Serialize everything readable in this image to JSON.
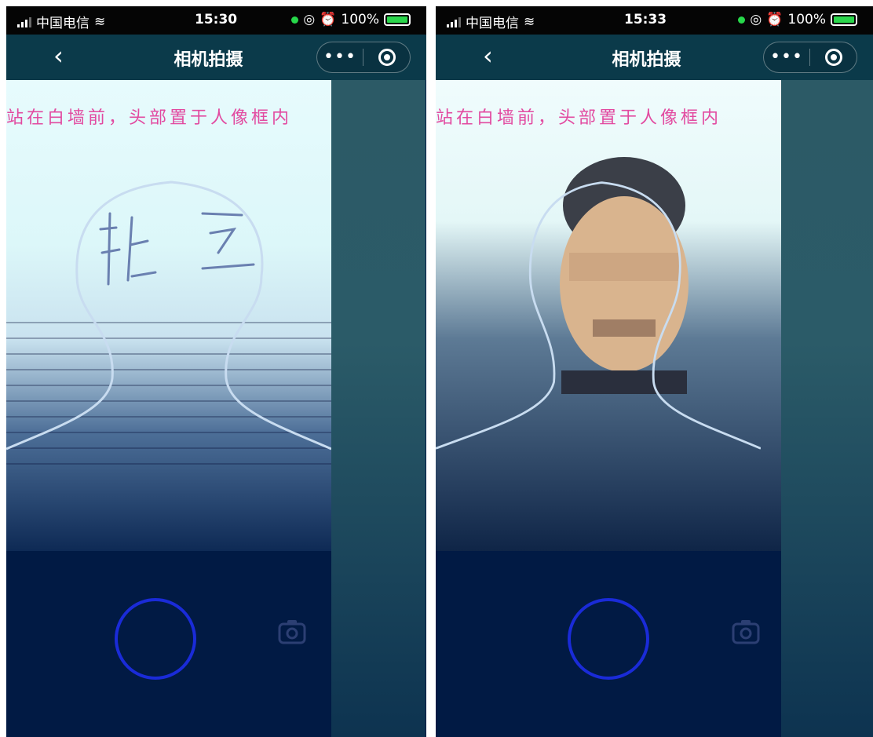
{
  "screens": [
    {
      "status": {
        "carrier": "中国电信",
        "time": "15:30",
        "battery": "100%"
      },
      "nav": {
        "back": "‹",
        "title": "相机拍摄",
        "more": "•••"
      },
      "hint": "站在白墙前，头部置于人像框内",
      "switch_label": ""
    },
    {
      "status": {
        "carrier": "中国电信",
        "time": "15:33",
        "battery": "100%"
      },
      "nav": {
        "back": "‹",
        "title": "相机拍摄",
        "more": "•••"
      },
      "hint": "站在白墙前，头部置于人像框内",
      "switch_label": ""
    }
  ],
  "icons": {
    "back": "chevron-left-icon",
    "more": "more-dots-icon",
    "record": "record-icon",
    "switch": "camera-switch-icon",
    "shutter": "shutter-button"
  },
  "colors": {
    "hint": "#e24aa0",
    "navbar": "#0b3a4a",
    "background": "#011a44",
    "shutter_ring": "#1a2bd8"
  }
}
